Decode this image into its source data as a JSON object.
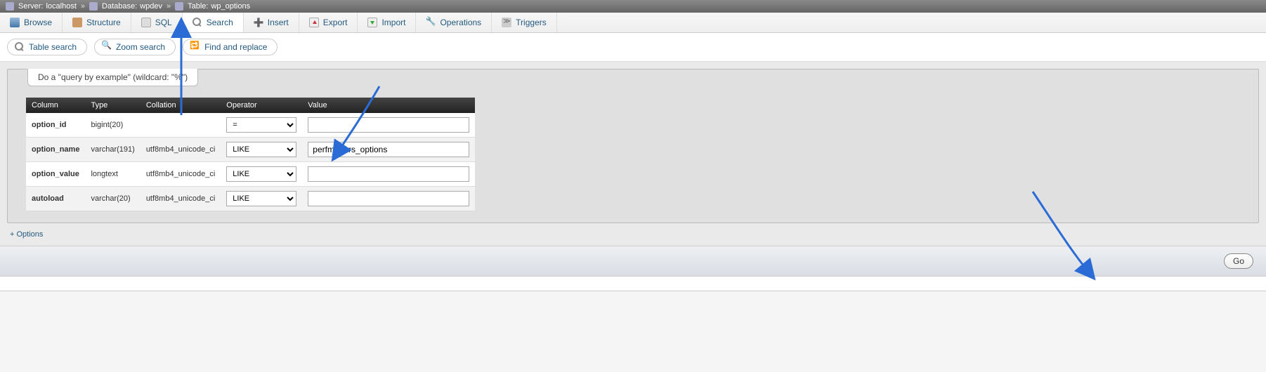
{
  "breadcrumb": {
    "server_label": "Server:",
    "server_value": "localhost",
    "database_label": "Database:",
    "database_value": "wpdev",
    "table_label": "Table:",
    "table_value": "wp_options",
    "sep": "»"
  },
  "topnav": {
    "browse": "Browse",
    "structure": "Structure",
    "sql": "SQL",
    "search": "Search",
    "insert": "Insert",
    "export": "Export",
    "import": "Import",
    "operations": "Operations",
    "triggers": "Triggers"
  },
  "subnav": {
    "table_search": "Table search",
    "zoom_search": "Zoom search",
    "find_replace": "Find and replace"
  },
  "panel": {
    "legend": "Do a \"query by example\" (wildcard: \"%\")"
  },
  "headers": {
    "column": "Column",
    "type": "Type",
    "collation": "Collation",
    "operator": "Operator",
    "value": "Value"
  },
  "rows": [
    {
      "column": "option_id",
      "type": "bigint(20)",
      "collation": "",
      "operator": "=",
      "value": ""
    },
    {
      "column": "option_name",
      "type": "varchar(191)",
      "collation": "utf8mb4_unicode_ci",
      "operator": "LIKE",
      "value": "perfmatters_options"
    },
    {
      "column": "option_value",
      "type": "longtext",
      "collation": "utf8mb4_unicode_ci",
      "operator": "LIKE",
      "value": ""
    },
    {
      "column": "autoload",
      "type": "varchar(20)",
      "collation": "utf8mb4_unicode_ci",
      "operator": "LIKE",
      "value": ""
    }
  ],
  "options_link": "+ Options",
  "go_button": "Go"
}
